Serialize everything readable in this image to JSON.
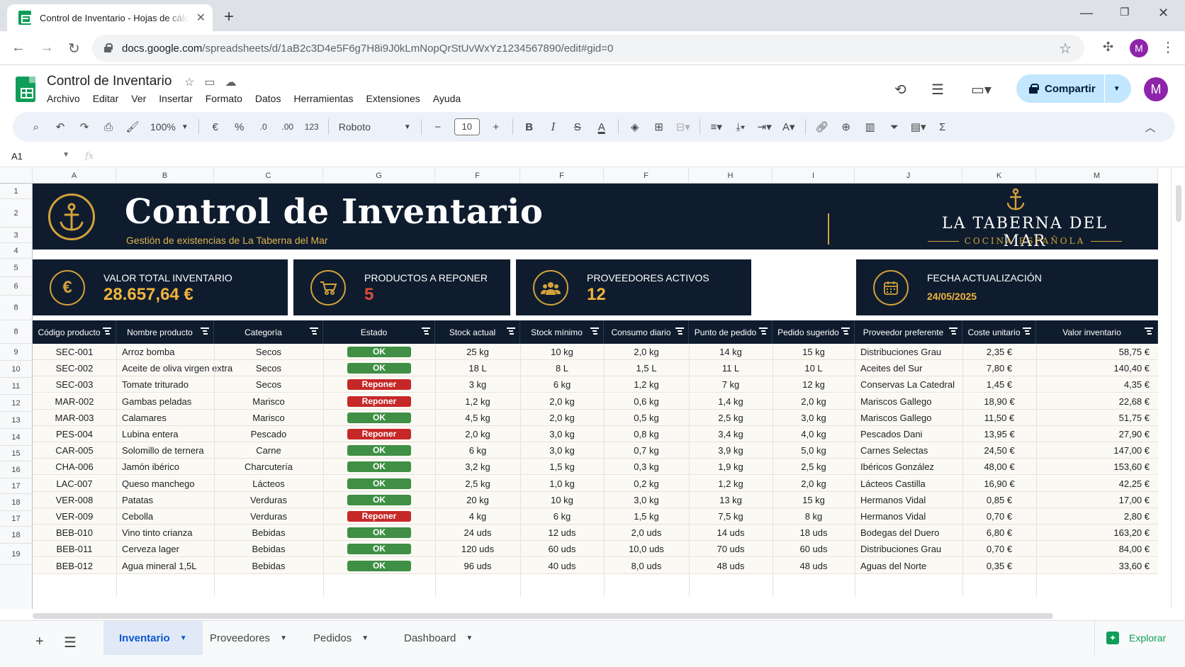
{
  "browser": {
    "tab_title": "Control de Inventario - Hojas de cálculo de Google",
    "url_host": "docs.google.com",
    "url_path": "/spreadsheets/d/1aB2c3D4e5F6g7H8i9J0kLmNopQrStUvWxYz1234567890/edit#gid=0",
    "profile_initial": "M"
  },
  "docs": {
    "title": "Control de Inventario",
    "menu": [
      "Archivo",
      "Editar",
      "Ver",
      "Insertar",
      "Formato",
      "Datos",
      "Herramientas",
      "Extensiones",
      "Ayuda"
    ],
    "share_label": "Compartir",
    "avatar_initial": "M"
  },
  "toolbar": {
    "zoom": "100%",
    "currency": "€",
    "percent": "%",
    "dec_less": ".0",
    "dec_more": ".00",
    "number_format": "123",
    "font": "Roboto",
    "font_size": "10"
  },
  "formula_bar": {
    "cell_ref": "A1",
    "fx": "fx"
  },
  "columns": [
    "A",
    "B",
    "C",
    "G",
    "F",
    "F",
    "F",
    "H",
    "I",
    "J",
    "K",
    "M"
  ],
  "row_numbers": [
    "1",
    "2",
    "3",
    "4",
    "5",
    "6",
    "8",
    "8",
    "9",
    "10",
    "11",
    "12",
    "13",
    "14",
    "15",
    "16",
    "17",
    "18",
    "17",
    "18",
    "19"
  ],
  "banner": {
    "title": "Control de Inventario",
    "subtitle": "Gestión de existencias de La Taberna del Mar",
    "brand": "LA TABERNA DEL MAR",
    "brand_sub": "COCINA ESPAÑOLA"
  },
  "kpis": [
    {
      "label": "VALOR TOTAL INVENTARIO",
      "value": "28.657,64 €",
      "icon": "euro-icon"
    },
    {
      "label": "PRODUCTOS A REPONER",
      "value": "5",
      "icon": "cart-icon"
    },
    {
      "label": "PROVEEDORES ACTIVOS",
      "value": "12",
      "icon": "people-icon"
    },
    {
      "label": "FECHA ACTUALIZACIÓN",
      "value": "24/05/2025",
      "icon": "calendar-icon"
    }
  ],
  "table": {
    "headers": [
      "Código producto",
      "Nombre producto",
      "Categoría",
      "Estado",
      "Stock actual",
      "Stock mínimo",
      "Consumo diario",
      "Punto de pedido",
      "Pedido sugerido",
      "Proveedor preferente",
      "Coste unitario",
      "Valor inventario"
    ],
    "rows": [
      [
        "SEC-001",
        "Arroz bomba",
        "Secos",
        "OK",
        "25 kg",
        "10 kg",
        "2,0 kg",
        "14 kg",
        "15 kg",
        "Distribuciones Grau",
        "2,35 €",
        "58,75 €"
      ],
      [
        "SEC-002",
        "Aceite de oliva virgen extra",
        "Secos",
        "OK",
        "18 L",
        "8 L",
        "1,5 L",
        "11 L",
        "10 L",
        "Aceites del Sur",
        "7,80 €",
        "140,40 €"
      ],
      [
        "SEC-003",
        "Tomate triturado",
        "Secos",
        "Reponer",
        "3 kg",
        "6 kg",
        "1,2 kg",
        "7 kg",
        "12 kg",
        "Conservas La Catedral",
        "1,45 €",
        "4,35 €"
      ],
      [
        "MAR-002",
        "Gambas peladas",
        "Marisco",
        "Reponer",
        "1,2 kg",
        "2,0 kg",
        "0,6 kg",
        "1,4 kg",
        "2,0 kg",
        "Mariscos Gallego",
        "18,90 €",
        "22,68 €"
      ],
      [
        "MAR-003",
        "Calamares",
        "Marisco",
        "OK",
        "4,5 kg",
        "2,0 kg",
        "0,5 kg",
        "2,5 kg",
        "3,0 kg",
        "Mariscos Gallego",
        "11,50 €",
        "51,75 €"
      ],
      [
        "PES-004",
        "Lubina entera",
        "Pescado",
        "Reponer",
        "2,0 kg",
        "3,0 kg",
        "0,8 kg",
        "3,4 kg",
        "4,0 kg",
        "Pescados Dani",
        "13,95 €",
        "27,90 €"
      ],
      [
        "CAR-005",
        "Solomillo de ternera",
        "Carne",
        "OK",
        "6 kg",
        "3,0 kg",
        "0,7 kg",
        "3,9 kg",
        "5,0 kg",
        "Carnes Selectas",
        "24,50 €",
        "147,00 €"
      ],
      [
        "CHA-006",
        "Jamón ibérico",
        "Charcutería",
        "OK",
        "3,2 kg",
        "1,5 kg",
        "0,3 kg",
        "1,9 kg",
        "2,5 kg",
        "Ibéricos González",
        "48,00 €",
        "153,60 €"
      ],
      [
        "LAC-007",
        "Queso manchego",
        "Lácteos",
        "OK",
        "2,5 kg",
        "1,0 kg",
        "0,2 kg",
        "1,2 kg",
        "2,0 kg",
        "Lácteos Castilla",
        "16,90 €",
        "42,25 €"
      ],
      [
        "VER-008",
        "Patatas",
        "Verduras",
        "OK",
        "20 kg",
        "10 kg",
        "3,0 kg",
        "13 kg",
        "15 kg",
        "Hermanos Vidal",
        "0,85 €",
        "17,00 €"
      ],
      [
        "VER-009",
        "Cebolla",
        "Verduras",
        "Reponer",
        "4 kg",
        "6 kg",
        "1,5 kg",
        "7,5 kg",
        "8 kg",
        "Hermanos Vidal",
        "0,70 €",
        "2,80 €"
      ],
      [
        "BEB-010",
        "Vino tinto crianza",
        "Bebidas",
        "OK",
        "24 uds",
        "12 uds",
        "2,0 uds",
        "14 uds",
        "18 uds",
        "Bodegas del Duero",
        "6,80 €",
        "163,20 €"
      ],
      [
        "BEB-011",
        "Cerveza lager",
        "Bebidas",
        "OK",
        "120 uds",
        "60 uds",
        "10,0 uds",
        "70 uds",
        "60 uds",
        "Distribuciones Grau",
        "0,70 €",
        "84,00 €"
      ],
      [
        "BEB-012",
        "Agua mineral 1,5L",
        "Bebidas",
        "OK",
        "96 uds",
        "40 uds",
        "8,0 uds",
        "48 uds",
        "48 uds",
        "Aguas del Norte",
        "0,35 €",
        "33,60 €"
      ]
    ]
  },
  "sheets": [
    "Inventario",
    "Proveedores",
    "Pedidos",
    "Dashboard"
  ],
  "explore_label": "Explorar",
  "colors": {
    "navy": "#0f1c2e",
    "gold": "#d4a23a",
    "ok": "#3f8f45",
    "reponer": "#c62828"
  }
}
